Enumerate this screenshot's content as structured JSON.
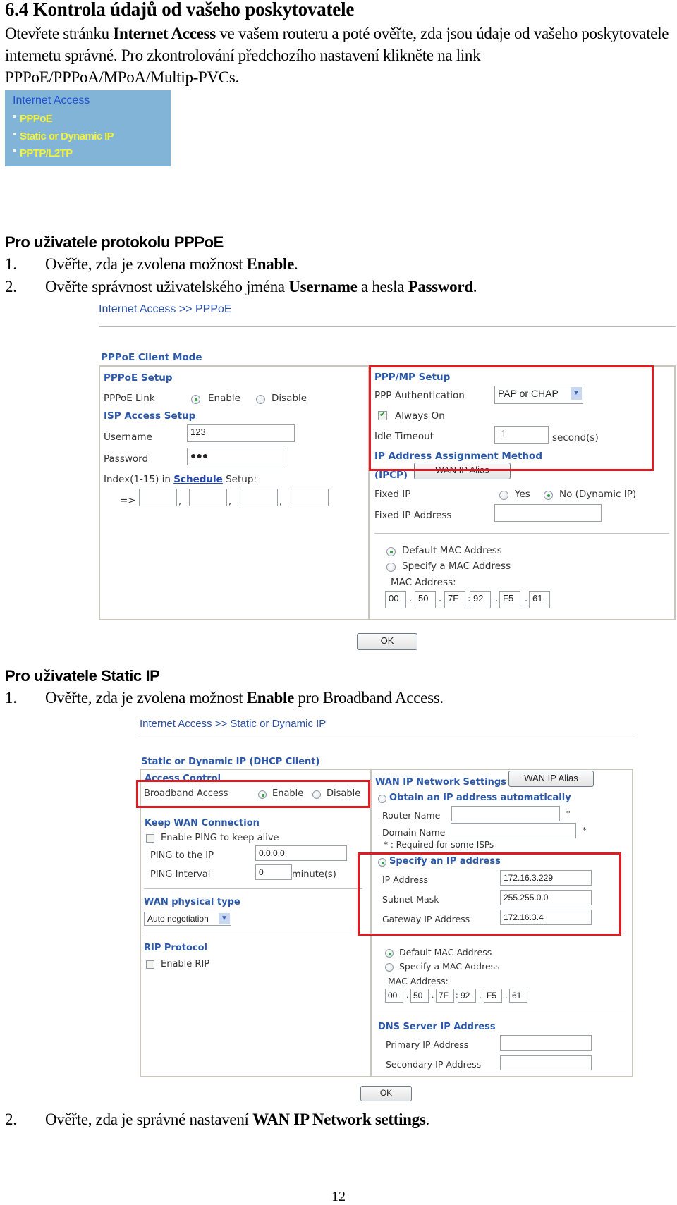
{
  "doc": {
    "title": "6.4 Kontrola údajů od vašeho poskytovatele",
    "intro": {
      "part1": "Otevřete stránku ",
      "bold1": "Internet Access",
      "part2": " ve vašem routeru a poté ověřte, zda jsou údaje od vašeho poskytovatele internetu správné. Pro zkontrolování předchozího nastavení klikněte na link PPPoE/PPPoA/MPoA/Multip-PVCs."
    },
    "page_number": "12"
  },
  "internet_access_menu": {
    "header": "Internet Access",
    "items": [
      "PPPoE",
      "Static or Dynamic IP",
      "PPTP/L2TP"
    ]
  },
  "pppoe_section": {
    "heading": "Pro uživatele protokolu PPPoE",
    "steps": [
      {
        "num": "1.",
        "text1": "Ověřte, zda je zvolena možnost ",
        "bold1": "Enable",
        "text2": ".",
        "bold2": "",
        "text3": ""
      },
      {
        "num": "2.",
        "text1": "Ověřte správnost uživatelského jména ",
        "bold1": "Username",
        "text2": " a hesla ",
        "bold2": "Password",
        "text3": "."
      }
    ],
    "panel": {
      "breadcrumb": "Internet Access >> PPPoE",
      "client_mode_title": "PPPoE Client Mode",
      "pppoe_setup": {
        "title": "PPPoE Setup",
        "link_label": "PPPoE Link",
        "enable_label": "Enable",
        "disable_label": "Disable",
        "selected": "Enable"
      },
      "isp_access": {
        "title": "ISP Access Setup",
        "username_label": "Username",
        "username_value": "123",
        "password_label": "Password",
        "password_value": "●●●",
        "index_prefix": "Index(1-15) in ",
        "schedule_link": "Schedule",
        "index_suffix": " Setup:",
        "arrow": "=>",
        "schedule_values": [
          "",
          "",
          "",
          ""
        ]
      },
      "ppp_mp_setup": {
        "title": "PPP/MP Setup",
        "auth_label": "PPP Authentication",
        "auth_value": "PAP or CHAP",
        "always_on_label": "Always On",
        "always_on_checked": true,
        "idle_label": "Idle Timeout",
        "idle_value": "-1",
        "idle_unit": "second(s)"
      },
      "ip_assignment": {
        "title": "IP Address Assignment Method",
        "title2": "(IPCP)",
        "wan_alias_button": "WAN IP Alias",
        "fixed_ip_label": "Fixed IP",
        "yes_label": "Yes",
        "no_label": "No (Dynamic IP)",
        "selected": "No (Dynamic IP)",
        "fixed_ip_address_label": "Fixed IP Address",
        "fixed_ip_address_value": ""
      },
      "mac": {
        "default_label": "Default MAC Address",
        "specify_label": "Specify a MAC Address",
        "selected": "Default MAC Address",
        "mac_label": "MAC Address:",
        "octets": [
          "00",
          "50",
          "7F",
          "92",
          "F5",
          "61"
        ],
        "separators": [
          ".",
          ".",
          ":",
          ".",
          "."
        ]
      },
      "ok_button": "OK"
    }
  },
  "static_section": {
    "heading": "Pro uživatele Static IP",
    "step1": {
      "num": "1.",
      "text1": "Ověřte, zda je zvolena možnost ",
      "bold1": "Enable",
      "text2": " pro Broadband Access."
    },
    "step2": {
      "num": "2.",
      "text1": "Ověřte, zda je správné nastavení ",
      "bold1": "WAN IP Network settings",
      "text2": "."
    },
    "panel": {
      "breadcrumb": "Internet Access >> Static or Dynamic IP",
      "mode_title": "Static or Dynamic IP (DHCP Client)",
      "access_control": {
        "title": "Access Control",
        "broadband_label": "Broadband Access",
        "enable_label": "Enable",
        "disable_label": "Disable",
        "selected": "Enable"
      },
      "keep_wan": {
        "title": "Keep WAN Connection",
        "ping_enable_label": "Enable PING to keep alive",
        "ping_enable_checked": false,
        "ping_ip_label": "PING to the IP",
        "ping_ip_value": "0.0.0.0",
        "ping_interval_label": "PING Interval",
        "ping_interval_value": "0",
        "ping_interval_unit": "minute(s)"
      },
      "wan_physical": {
        "title": "WAN physical type",
        "value": "Auto negotiation"
      },
      "rip": {
        "title": "RIP Protocol",
        "enable_label": "Enable RIP",
        "checked": false
      },
      "wan_ip": {
        "title": "WAN IP Network Settings",
        "alias_button": "WAN IP Alias",
        "obtain_label": "Obtain an IP address automatically",
        "router_name_label": "Router Name",
        "router_name_value": "",
        "domain_name_label": "Domain Name",
        "domain_name_value": "",
        "asterisk": "*",
        "required_note": "* : Required for some ISPs",
        "specify_label": "Specify an IP address",
        "selected": "Specify an IP address",
        "ip_label": "IP Address",
        "ip_value": "172.16.3.229",
        "mask_label": "Subnet Mask",
        "mask_value": "255.255.0.0",
        "gateway_label": "Gateway IP Address",
        "gateway_value": "172.16.3.4"
      },
      "mac": {
        "default_label": "Default MAC Address",
        "specify_label": "Specify a MAC Address",
        "selected": "Default MAC Address",
        "mac_label": "MAC Address:",
        "octets": [
          "00",
          "50",
          "7F",
          "92",
          "F5",
          "61"
        ],
        "separators": [
          ".",
          ".",
          ":",
          ".",
          "."
        ]
      },
      "dns": {
        "title": "DNS Server IP Address",
        "primary_label": "Primary IP Address",
        "primary_value": "",
        "secondary_label": "Secondary IP Address",
        "secondary_value": ""
      },
      "ok_button": "OK"
    }
  },
  "colors": {
    "highlight_red": "#e01b22",
    "ui_blue": "#2b58a8",
    "menu_bg": "#82b4d8",
    "menu_item": "#f3f33a"
  }
}
